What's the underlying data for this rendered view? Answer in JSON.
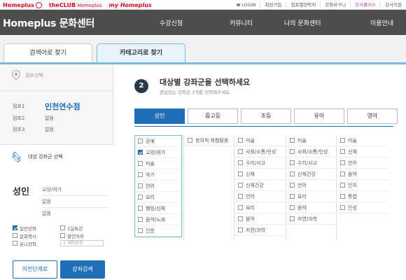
{
  "brands": {
    "homeplus": "Homeplus",
    "club": "theCLUB",
    "club_sub": "Homeplus",
    "my": "my Homeplus"
  },
  "util_links": [
    {
      "label": "LOGIN",
      "accent": false
    },
    {
      "label": "회원가입",
      "accent": false
    },
    {
      "label": "점포별연락처",
      "accent": false
    },
    {
      "label": "강좌바구니",
      "accent": false
    },
    {
      "label": "강사플러스",
      "accent": true
    },
    {
      "label": "강사지원",
      "accent": false
    }
  ],
  "logo": "Homeplus 문화센터",
  "nav": [
    "수강신청",
    "커뮤니티",
    "나의 문화센터",
    "이용안내"
  ],
  "tabs": [
    "검색어로 찾기",
    "카테고리로 찾기"
  ],
  "left": {
    "location_label": "점포선택",
    "stores": [
      {
        "key": "점포1",
        "value": "인천연수점"
      },
      {
        "key": "점포2",
        "value": "없음"
      },
      {
        "key": "점포3",
        "value": "없음"
      }
    ],
    "target_title": "대상 강좌군 선택",
    "selected_group": "성인",
    "selected_items": [
      "교양/여가",
      "없음",
      "없음"
    ],
    "options": [
      {
        "label": "일반강좌",
        "checked": true
      },
      {
        "label": "1일특강",
        "checked": false
      },
      {
        "label": "문화행사",
        "checked": false
      },
      {
        "label": "할인여부",
        "checked": false
      },
      {
        "label": "온니강좌",
        "checked": false
      },
      {
        "label": "테마강좌",
        "dropdown": true
      }
    ],
    "btn_prev": "이전단계로",
    "btn_search": "강좌검색"
  },
  "step": {
    "number": "2",
    "title": "대상별 강좌군을 선택하세요",
    "subtitle": "관심있는 강좌군 3개를 선택해주세요."
  },
  "age_tabs": [
    {
      "label": "성인",
      "active": true
    },
    {
      "label": "중고등",
      "active": false
    },
    {
      "label": "초등",
      "active": false
    },
    {
      "label": "유아",
      "active": false
    },
    {
      "label": "영아",
      "active": false
    }
  ],
  "columns": [
    [
      {
        "label": "공예",
        "checked": false
      },
      {
        "label": "교양/여가",
        "checked": true
      },
      {
        "label": "미술",
        "checked": false
      },
      {
        "label": "악기",
        "checked": false
      },
      {
        "label": "언어",
        "checked": false
      },
      {
        "label": "요리",
        "checked": false
      },
      {
        "label": "웰빙/신체",
        "checked": false
      },
      {
        "label": "음악/노래",
        "checked": false
      },
      {
        "label": "인문",
        "checked": false
      }
    ],
    [
      {
        "label": "창의적 체험활동",
        "checked": false
      }
    ],
    [
      {
        "label": "미술",
        "checked": false
      },
      {
        "label": "사회/소통/인성",
        "checked": false
      },
      {
        "label": "수리/사고",
        "checked": false
      },
      {
        "label": "신체",
        "checked": false
      },
      {
        "label": "신체건강",
        "checked": false
      },
      {
        "label": "언어",
        "checked": false
      },
      {
        "label": "요리",
        "checked": false
      },
      {
        "label": "음악",
        "checked": false
      },
      {
        "label": "자연/과학",
        "checked": false
      }
    ],
    [
      {
        "label": "미술",
        "checked": false
      },
      {
        "label": "사회/소통/인성",
        "checked": false
      },
      {
        "label": "수리/사고",
        "checked": false
      },
      {
        "label": "신체건강",
        "checked": false
      },
      {
        "label": "언어",
        "checked": false
      },
      {
        "label": "요리",
        "checked": false
      },
      {
        "label": "음악",
        "checked": false
      },
      {
        "label": "자연/과학",
        "checked": false
      }
    ],
    [
      {
        "label": "미술",
        "checked": false
      },
      {
        "label": "신체",
        "checked": false
      },
      {
        "label": "언어",
        "checked": false
      },
      {
        "label": "음악",
        "checked": false
      },
      {
        "label": "인지",
        "checked": false
      },
      {
        "label": "통합",
        "checked": false
      },
      {
        "label": "인성",
        "checked": false
      }
    ]
  ],
  "colors": {
    "accent": "#1f6fb8",
    "nav_bg": "#4d4d4d",
    "brand_red": "#e1001b",
    "tab_border": "#7bb9de"
  }
}
